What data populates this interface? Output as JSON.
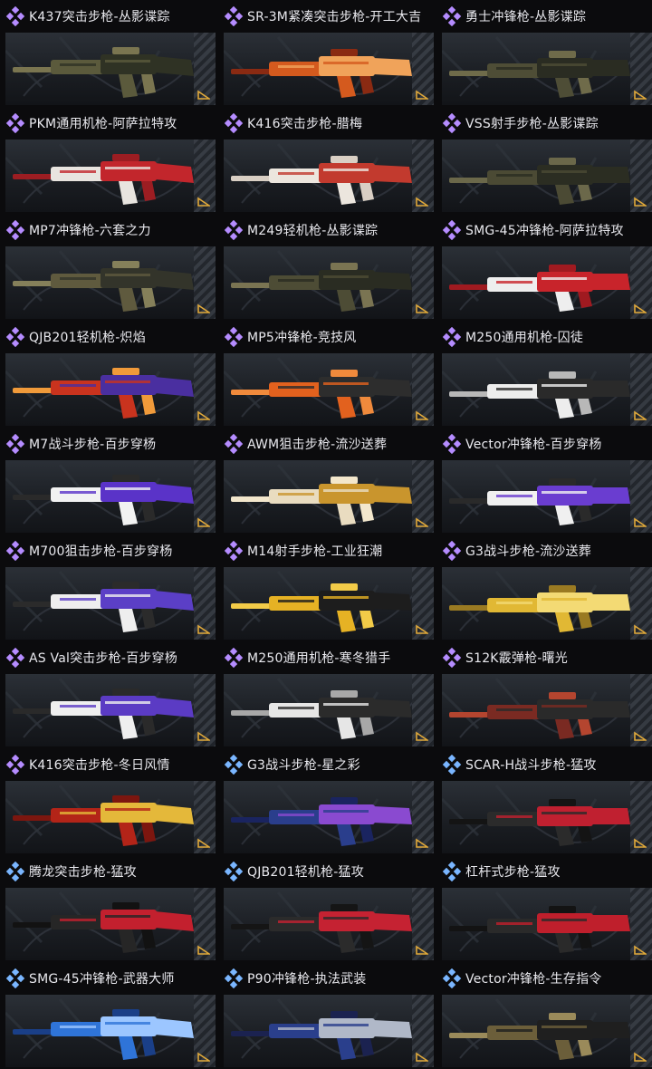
{
  "colors": {
    "purple_rarity": "#b58cff",
    "blue_rarity": "#7ab6ff",
    "corner_gold": "#e0a93a"
  },
  "skins": [
    {
      "title": "K437突击步枪-丛影谍踪",
      "rarity": "purple",
      "palette": [
        "#5b5a3c",
        "#2f3224",
        "#7a7550"
      ]
    },
    {
      "title": "SR-3M紧凑突击步枪-开工大吉",
      "rarity": "purple",
      "palette": [
        "#d45a1e",
        "#f0a35a",
        "#8a2a12"
      ]
    },
    {
      "title": "勇士冲锋枪-丛影谍踪",
      "rarity": "purple",
      "palette": [
        "#4e4d36",
        "#2a2c22",
        "#6f6b4a"
      ]
    },
    {
      "title": "PKM通用机枪-阿萨拉特攻",
      "rarity": "purple",
      "palette": [
        "#e8e4df",
        "#c2262c",
        "#9c1d22"
      ]
    },
    {
      "title": "K416突击步枪-腊梅",
      "rarity": "purple",
      "palette": [
        "#ece6de",
        "#c23a2e",
        "#d9cfc4"
      ]
    },
    {
      "title": "VSS射手步枪-丛影谍踪",
      "rarity": "purple",
      "palette": [
        "#4b4a34",
        "#2b2d22",
        "#6b684a"
      ]
    },
    {
      "title": "MP7冲锋枪-六套之力",
      "rarity": "purple",
      "palette": [
        "#5f5a3e",
        "#33342a",
        "#85805a"
      ]
    },
    {
      "title": "M249轻机枪-丛影谍踪",
      "rarity": "purple",
      "palette": [
        "#4d4c35",
        "#2a2c22",
        "#7a7452"
      ]
    },
    {
      "title": "SMG-45冲锋枪-阿萨拉特攻",
      "rarity": "purple",
      "palette": [
        "#eeeeee",
        "#c8242b",
        "#a01a20"
      ]
    },
    {
      "title": "QJB201轻机枪-炽焰",
      "rarity": "purple",
      "palette": [
        "#c9331e",
        "#4a2fa0",
        "#f09a3a"
      ]
    },
    {
      "title": "MP5冲锋枪-竞技风",
      "rarity": "purple",
      "palette": [
        "#e2611e",
        "#2d2d2d",
        "#f08a3c"
      ]
    },
    {
      "title": "M250通用机枪-囚徒",
      "rarity": "purple",
      "palette": [
        "#ededed",
        "#2a2a2a",
        "#b8b8b8"
      ]
    },
    {
      "title": "M7战斗步枪-百步穿杨",
      "rarity": "purple",
      "palette": [
        "#f2f2f2",
        "#5a33c8",
        "#2a2a2a"
      ]
    },
    {
      "title": "AWM狙击步枪-流沙送葬",
      "rarity": "purple",
      "palette": [
        "#e9dcc0",
        "#c9952d",
        "#f3e7cc"
      ]
    },
    {
      "title": "Vector冲锋枪-百步穿杨",
      "rarity": "purple",
      "palette": [
        "#f0f0f0",
        "#6a3dd0",
        "#2a2a2a"
      ]
    },
    {
      "title": "M700狙击步枪-百步穿杨",
      "rarity": "purple",
      "palette": [
        "#eeeeee",
        "#5b3fc6",
        "#2b2b2b"
      ]
    },
    {
      "title": "M14射手步枪-工业狂潮",
      "rarity": "purple",
      "palette": [
        "#e6b224",
        "#1d1d1d",
        "#f2cb48"
      ]
    },
    {
      "title": "G3战斗步枪-流沙送葬",
      "rarity": "purple",
      "palette": [
        "#e1b834",
        "#f3da74",
        "#9a7a22"
      ]
    },
    {
      "title": "AS Val突击步枪-百步穿杨",
      "rarity": "purple",
      "palette": [
        "#efefef",
        "#5b3bc4",
        "#2a2a2a"
      ]
    },
    {
      "title": "M250通用机枪-寒冬猎手",
      "rarity": "purple",
      "palette": [
        "#e6e6e6",
        "#2b2b2b",
        "#a8a8a8"
      ]
    },
    {
      "title": "S12K霰弹枪-曙光",
      "rarity": "purple",
      "palette": [
        "#7a2a22",
        "#2a2a2a",
        "#b4452f"
      ]
    },
    {
      "title": "K416突击步枪-冬日风情",
      "rarity": "purple",
      "palette": [
        "#b32418",
        "#e4b83a",
        "#7c160f"
      ]
    },
    {
      "title": "G3战斗步枪-星之彩",
      "rarity": "blue",
      "palette": [
        "#2a3e8c",
        "#8a4ad0",
        "#1a2460"
      ]
    },
    {
      "title": "SCAR-H战斗步枪-猛攻",
      "rarity": "blue",
      "palette": [
        "#2b2b2b",
        "#c02030",
        "#141414"
      ]
    },
    {
      "title": "腾龙突击步枪-猛攻",
      "rarity": "blue",
      "palette": [
        "#262626",
        "#c3202e",
        "#121212"
      ]
    },
    {
      "title": "QJB201轻机枪-猛攻",
      "rarity": "blue",
      "palette": [
        "#2b2b2b",
        "#c52232",
        "#151515"
      ]
    },
    {
      "title": "杠杆式步枪-猛攻",
      "rarity": "blue",
      "palette": [
        "#2a2a2a",
        "#bf1f2c",
        "#131313"
      ]
    },
    {
      "title": "SMG-45冲锋枪-武器大师",
      "rarity": "blue",
      "palette": [
        "#2f74d8",
        "#9cc6ff",
        "#1a3f88"
      ]
    },
    {
      "title": "P90冲锋枪-执法武装",
      "rarity": "blue",
      "palette": [
        "#2a3f8c",
        "#b0b8c8",
        "#1b2250"
      ]
    },
    {
      "title": "Vector冲锋枪-生存指令",
      "rarity": "blue",
      "palette": [
        "#6b5e3a",
        "#1f1f1f",
        "#9a8a5a"
      ]
    }
  ]
}
